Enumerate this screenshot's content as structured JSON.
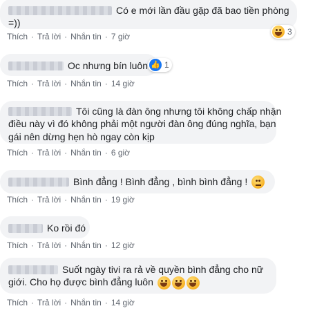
{
  "actions": {
    "like": "Thích",
    "reply": "Trả lời",
    "message": "Nhắn tin",
    "sep": "·"
  },
  "comments": [
    {
      "line1": "Có e mới lần đầu gặp đã bao tiền phòng",
      "line2": "=))",
      "time": "7 giờ",
      "reaction_count": "3",
      "reaction_icon": "laugh-icon"
    },
    {
      "line1": "Oc nhưng bín luôn",
      "time": "14 giờ",
      "reaction_count": "1",
      "reaction_icon": "like-icon"
    },
    {
      "line1": "Tôi cũng là đàn ông nhưng tôi không chấp nhận",
      "line2": "điều này vì đó không phải một người đàn ông đúng nghĩa, bạn",
      "line3": "gái nên dừng hẹn hò ngay còn kịp",
      "time": "6 giờ"
    },
    {
      "line1": "Bình đẳng ! Bình đẳng , bình bình đẳng !",
      "time": "19 giờ",
      "inline_icon": "thinking-icon"
    },
    {
      "line1": "Ko rồi đó",
      "time": "12 giờ"
    },
    {
      "line1": "Suốt ngày tivi ra rả về quyền bình đẳng cho nữ",
      "line2": "giới. Cho họ được bình đẳng luôn",
      "time": "14 giờ",
      "inline_icon": "laugh-icon"
    }
  ]
}
